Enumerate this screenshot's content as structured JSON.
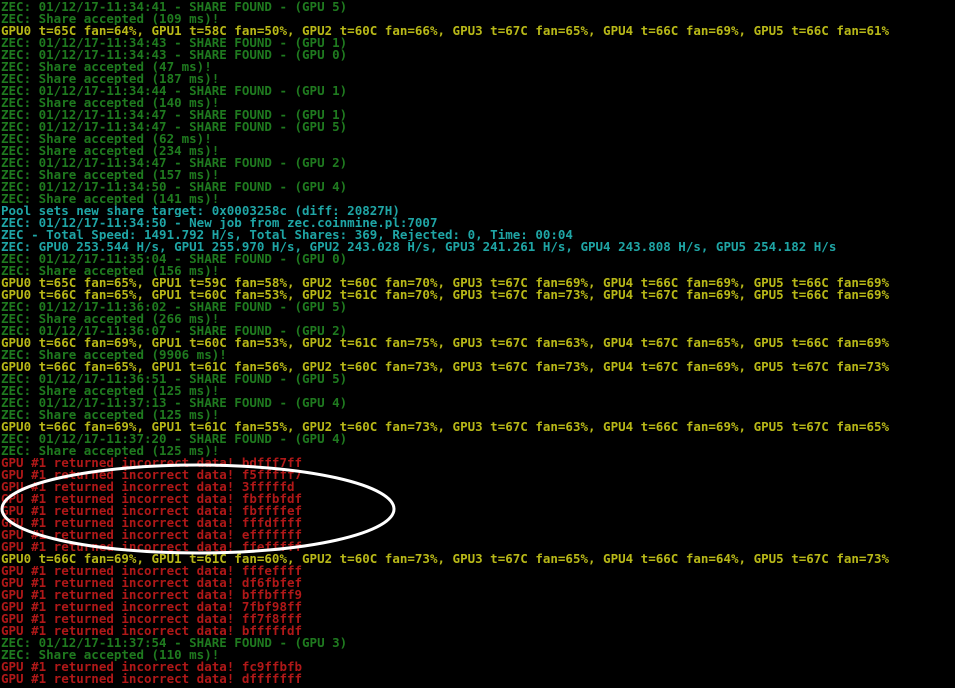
{
  "colors": {
    "background": "#000000",
    "green": "#1f7a1f",
    "yellow": "#b8b818",
    "cyan": "#1fa5a5",
    "red": "#b01818",
    "annotation": "#ffffff"
  },
  "lines": [
    {
      "color": "green",
      "text": "ZEC: 01/12/17-11:34:41 - SHARE FOUND - (GPU 5)"
    },
    {
      "color": "green",
      "text": "ZEC: Share accepted (109 ms)!"
    },
    {
      "color": "yellow",
      "text": "GPU0 t=65C fan=64%, GPU1 t=58C fan=50%, GPU2 t=60C fan=66%, GPU3 t=67C fan=65%, GPU4 t=66C fan=69%, GPU5 t=66C fan=61%"
    },
    {
      "color": "green",
      "text": "ZEC: 01/12/17-11:34:43 - SHARE FOUND - (GPU 1)"
    },
    {
      "color": "green",
      "text": "ZEC: 01/12/17-11:34:43 - SHARE FOUND - (GPU 0)"
    },
    {
      "color": "green",
      "text": "ZEC: Share accepted (47 ms)!"
    },
    {
      "color": "green",
      "text": "ZEC: Share accepted (187 ms)!"
    },
    {
      "color": "green",
      "text": "ZEC: 01/12/17-11:34:44 - SHARE FOUND - (GPU 1)"
    },
    {
      "color": "green",
      "text": "ZEC: Share accepted (140 ms)!"
    },
    {
      "color": "green",
      "text": "ZEC: 01/12/17-11:34:47 - SHARE FOUND - (GPU 1)"
    },
    {
      "color": "green",
      "text": "ZEC: 01/12/17-11:34:47 - SHARE FOUND - (GPU 5)"
    },
    {
      "color": "green",
      "text": "ZEC: Share accepted (62 ms)!"
    },
    {
      "color": "green",
      "text": "ZEC: Share accepted (234 ms)!"
    },
    {
      "color": "green",
      "text": "ZEC: 01/12/17-11:34:47 - SHARE FOUND - (GPU 2)"
    },
    {
      "color": "green",
      "text": "ZEC: Share accepted (157 ms)!"
    },
    {
      "color": "green",
      "text": "ZEC: 01/12/17-11:34:50 - SHARE FOUND - (GPU 4)"
    },
    {
      "color": "green",
      "text": "ZEC: Share accepted (141 ms)!"
    },
    {
      "color": "cyan",
      "text": "Pool sets new share target: 0x0003258c (diff: 20827H)"
    },
    {
      "color": "cyan",
      "text": "ZEC: 01/12/17-11:34:50 - New job from zec.coinmine.pl:7007"
    },
    {
      "color": "cyan",
      "text": "ZEC - Total Speed: 1491.792 H/s, Total Shares: 369, Rejected: 0, Time: 00:04"
    },
    {
      "color": "cyan",
      "text": "ZEC: GPU0 253.544 H/s, GPU1 255.970 H/s, GPU2 243.028 H/s, GPU3 241.261 H/s, GPU4 243.808 H/s, GPU5 254.182 H/s"
    },
    {
      "color": "green",
      "text": "ZEC: 01/12/17-11:35:04 - SHARE FOUND - (GPU 0)"
    },
    {
      "color": "green",
      "text": "ZEC: Share accepted (156 ms)!"
    },
    {
      "color": "yellow",
      "text": "GPU0 t=65C fan=65%, GPU1 t=59C fan=58%, GPU2 t=60C fan=70%, GPU3 t=67C fan=69%, GPU4 t=66C fan=69%, GPU5 t=66C fan=69%"
    },
    {
      "color": "yellow",
      "text": "GPU0 t=66C fan=65%, GPU1 t=60C fan=53%, GPU2 t=61C fan=70%, GPU3 t=67C fan=73%, GPU4 t=67C fan=69%, GPU5 t=66C fan=69%"
    },
    {
      "color": "green",
      "text": "ZEC: 01/12/17-11:36:02 - SHARE FOUND - (GPU 5)"
    },
    {
      "color": "green",
      "text": "ZEC: Share accepted (266 ms)!"
    },
    {
      "color": "green",
      "text": "ZEC: 01/12/17-11:36:07 - SHARE FOUND - (GPU 2)"
    },
    {
      "color": "yellow",
      "text": "GPU0 t=66C fan=69%, GPU1 t=60C fan=53%, GPU2 t=61C fan=75%, GPU3 t=67C fan=63%, GPU4 t=67C fan=65%, GPU5 t=66C fan=69%"
    },
    {
      "color": "green",
      "text": "ZEC: Share accepted (9906 ms)!"
    },
    {
      "color": "yellow",
      "text": "GPU0 t=66C fan=65%, GPU1 t=61C fan=56%, GPU2 t=60C fan=73%, GPU3 t=67C fan=73%, GPU4 t=67C fan=69%, GPU5 t=67C fan=73%"
    },
    {
      "color": "green",
      "text": "ZEC: 01/12/17-11:36:51 - SHARE FOUND - (GPU 5)"
    },
    {
      "color": "green",
      "text": "ZEC: Share accepted (125 ms)!"
    },
    {
      "color": "green",
      "text": "ZEC: 01/12/17-11:37:13 - SHARE FOUND - (GPU 4)"
    },
    {
      "color": "green",
      "text": "ZEC: Share accepted (125 ms)!"
    },
    {
      "color": "yellow",
      "text": "GPU0 t=66C fan=69%, GPU1 t=61C fan=55%, GPU2 t=60C fan=73%, GPU3 t=67C fan=63%, GPU4 t=66C fan=69%, GPU5 t=67C fan=65%"
    },
    {
      "color": "green",
      "text": "ZEC: 01/12/17-11:37:20 - SHARE FOUND - (GPU 4)"
    },
    {
      "color": "green",
      "text": "ZEC: Share accepted (125 ms)!"
    },
    {
      "color": "red",
      "text": "GPU #1 returned incorrect data! bdfff7ff"
    },
    {
      "color": "red",
      "text": "GPU #1 returned incorrect data! f5fffff7"
    },
    {
      "color": "red",
      "text": "GPU #1 returned incorrect data! 3fffffd"
    },
    {
      "color": "red",
      "text": "GPU #1 returned incorrect data! fbffbfdf"
    },
    {
      "color": "red",
      "text": "GPU #1 returned incorrect data! fbffffef"
    },
    {
      "color": "red",
      "text": "GPU #1 returned incorrect data! fffdffff"
    },
    {
      "color": "red",
      "text": "GPU #1 returned incorrect data! efffffff"
    },
    {
      "color": "red",
      "text": "GPU #1 returned incorrect data! ffefffff"
    },
    {
      "color": "yellow",
      "text": "GPU0 t=66C fan=69%, GPU1 t=61C fan=60%, GPU2 t=60C fan=73%, GPU3 t=67C fan=65%, GPU4 t=66C fan=64%, GPU5 t=67C fan=73%"
    },
    {
      "color": "red",
      "text": "GPU #1 returned incorrect data! fffeffff"
    },
    {
      "color": "red",
      "text": "GPU #1 returned incorrect data! df6fbfef"
    },
    {
      "color": "red",
      "text": "GPU #1 returned incorrect data! bffbfff9"
    },
    {
      "color": "red",
      "text": "GPU #1 returned incorrect data! 7fbf98ff"
    },
    {
      "color": "red",
      "text": "GPU #1 returned incorrect data! ff7f8fff"
    },
    {
      "color": "red",
      "text": "GPU #1 returned incorrect data! bfffffdf"
    },
    {
      "color": "green",
      "text": "ZEC: 01/12/17-11:37:54 - SHARE FOUND - (GPU 3)"
    },
    {
      "color": "green",
      "text": "ZEC: Share accepted (110 ms)!"
    },
    {
      "color": "red",
      "text": "GPU #1 returned incorrect data! fc9ffbfb"
    },
    {
      "color": "red",
      "text": "GPU #1 returned incorrect data! dfffffff"
    }
  ]
}
